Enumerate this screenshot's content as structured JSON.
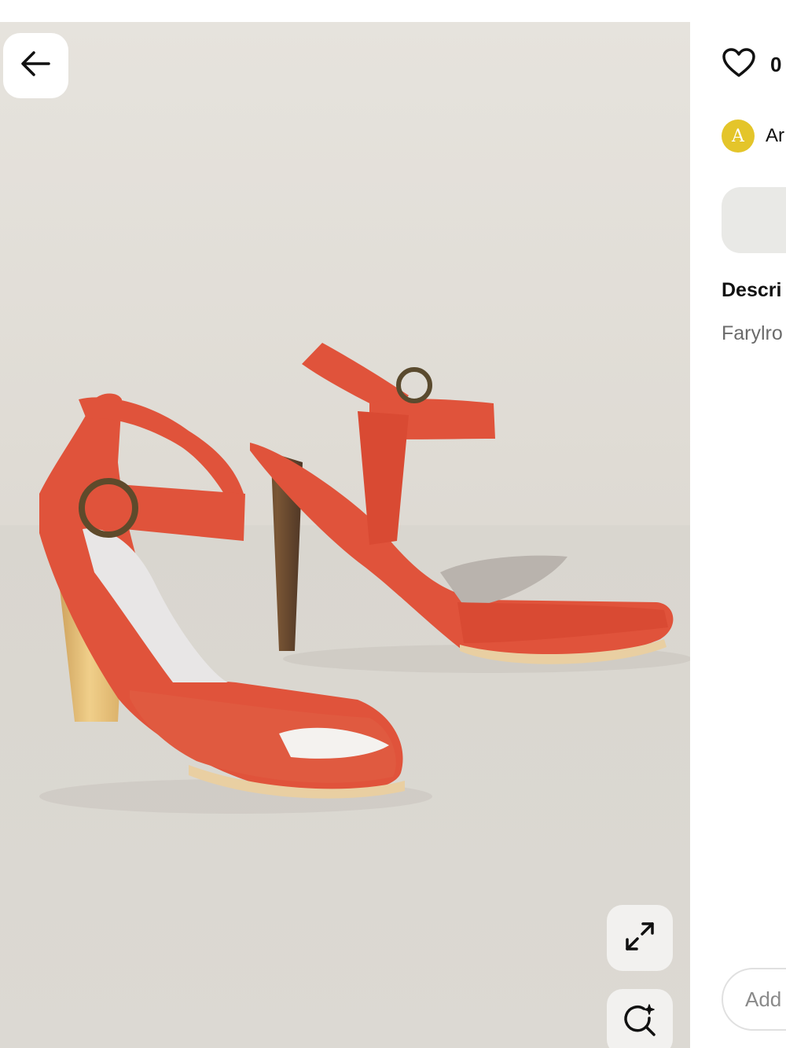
{
  "post": {
    "like_count": "0",
    "author_initial": "A",
    "author_name": "Ar",
    "description_heading": "Descri",
    "description_text": "Farylro"
  },
  "comment": {
    "placeholder": "Add"
  },
  "icons": {
    "back": "arrow-left-icon",
    "like": "heart-icon",
    "expand": "expand-icon",
    "visual_search": "lens-search-icon"
  },
  "colors": {
    "avatar": "#e4c52a",
    "pill": "#e9e9e6",
    "shoe": "#e0533b"
  }
}
